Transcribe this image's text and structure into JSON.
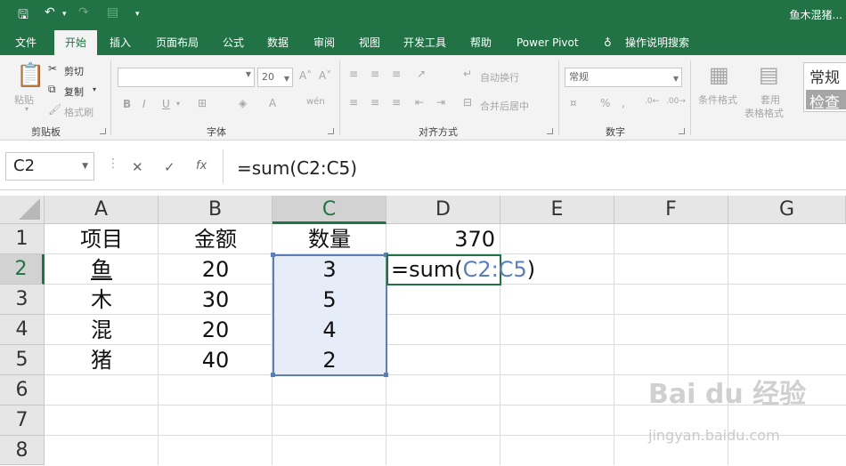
{
  "window": {
    "title": "鱼木混猪..."
  },
  "quick_access": {
    "save_icon": "save-icon",
    "undo_icon": "undo-icon",
    "redo_icon": "redo-icon",
    "form_icon": "form-icon",
    "customize_icon": "customize-icon"
  },
  "tabs": [
    {
      "label": "文件"
    },
    {
      "label": "开始"
    },
    {
      "label": "插入"
    },
    {
      "label": "页面布局"
    },
    {
      "label": "公式"
    },
    {
      "label": "数据"
    },
    {
      "label": "审阅"
    },
    {
      "label": "视图"
    },
    {
      "label": "开发工具"
    },
    {
      "label": "帮助"
    },
    {
      "label": "Power Pivot"
    },
    {
      "label": "操作说明搜索"
    }
  ],
  "ribbon": {
    "clipboard": {
      "paste": "粘贴",
      "cut": "剪切",
      "copy": "复制",
      "format_painter": "格式刷",
      "label": "剪贴板"
    },
    "font": {
      "font_name": "",
      "font_size": "20",
      "label": "字体",
      "bold": "B",
      "italic": "I",
      "underline": "U"
    },
    "alignment": {
      "wrap": "自动换行",
      "merge": "合并后居中",
      "label": "对齐方式"
    },
    "number": {
      "format": "常规",
      "label": "数字"
    },
    "styles": {
      "conditional": "条件格式",
      "table_format_1": "套用",
      "table_format_2": "表格格式",
      "style_normal": "常规",
      "style_check": "检查"
    }
  },
  "formula_bar": {
    "name_box": "C2",
    "cancel": "✕",
    "enter": "✓",
    "fx": "fx",
    "formula": "=sum(C2:C5)"
  },
  "columns": [
    "A",
    "B",
    "C",
    "D",
    "E",
    "F",
    "G"
  ],
  "rows": [
    "1",
    "2",
    "3",
    "4",
    "5",
    "6",
    "7",
    "8"
  ],
  "cells": {
    "A1": "项目",
    "B1": "金额",
    "C1": "数量",
    "D1": "370",
    "A2": "鱼",
    "B2": "20",
    "C2": "3",
    "A3": "木",
    "B3": "30",
    "C3": "5",
    "A4": "混",
    "B4": "20",
    "C4": "4",
    "A5": "猪",
    "B5": "40",
    "C5": "2"
  },
  "edit": {
    "prefix": "=sum(",
    "ref": "C2:C5",
    "suffix": ")"
  },
  "watermark": {
    "line1": "Bai du 经验",
    "line2": "jingyan.baidu.com"
  }
}
